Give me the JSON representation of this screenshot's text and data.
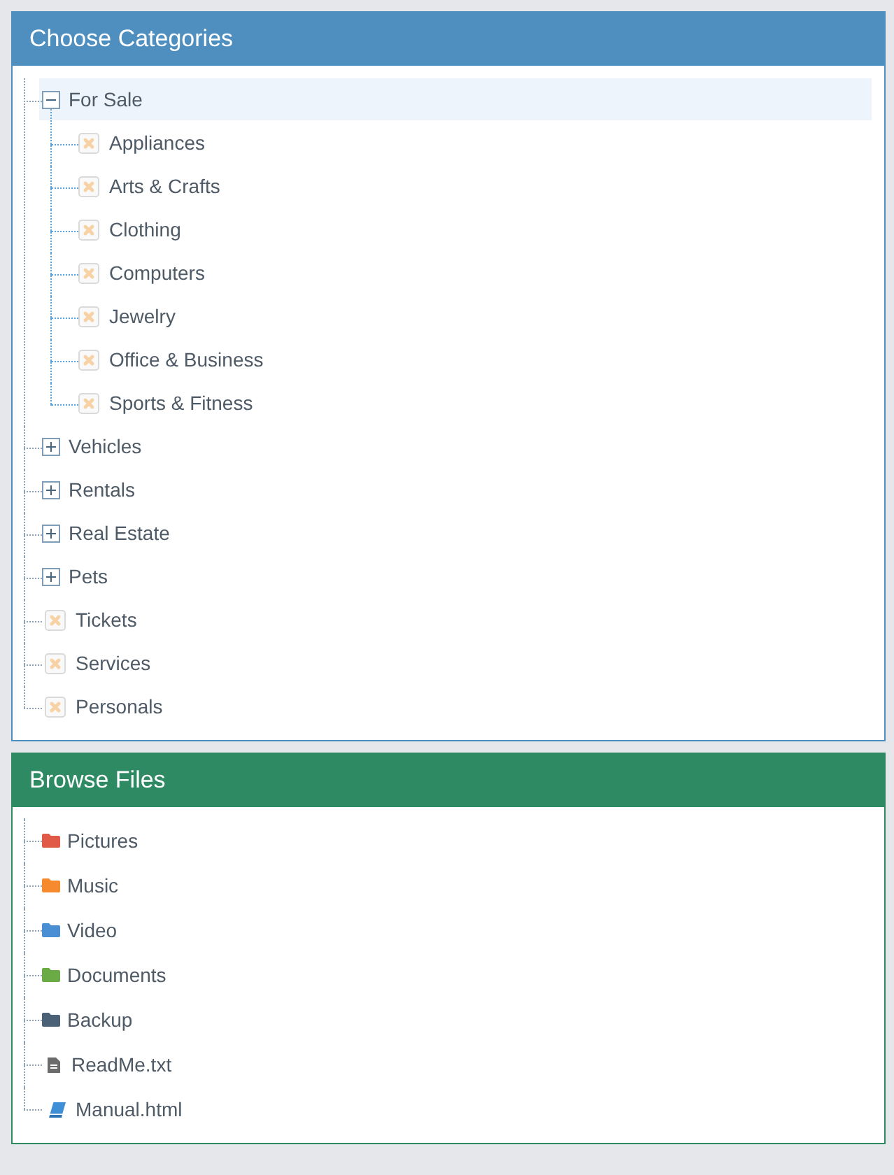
{
  "categories": {
    "title": "Choose Categories",
    "items": [
      {
        "label": "For Sale",
        "kind": "group",
        "expanded": true,
        "selected": true,
        "children": [
          {
            "label": "Appliances",
            "kind": "leaf",
            "selected": false
          },
          {
            "label": "Arts & Crafts",
            "kind": "leaf",
            "selected": false
          },
          {
            "label": "Clothing",
            "kind": "leaf",
            "selected": false
          },
          {
            "label": "Computers",
            "kind": "leaf",
            "selected": false
          },
          {
            "label": "Jewelry",
            "kind": "leaf",
            "selected": false
          },
          {
            "label": "Office & Business",
            "kind": "leaf",
            "selected": false
          },
          {
            "label": "Sports & Fitness",
            "kind": "leaf",
            "selected": false
          }
        ]
      },
      {
        "label": "Vehicles",
        "kind": "group",
        "expanded": false,
        "selected": false
      },
      {
        "label": "Rentals",
        "kind": "group",
        "expanded": false,
        "selected": false
      },
      {
        "label": "Real Estate",
        "kind": "group",
        "expanded": false,
        "selected": false
      },
      {
        "label": "Pets",
        "kind": "group",
        "expanded": false,
        "selected": false
      },
      {
        "label": "Tickets",
        "kind": "leaf",
        "selected": false
      },
      {
        "label": "Services",
        "kind": "leaf",
        "selected": false
      },
      {
        "label": "Personals",
        "kind": "leaf",
        "selected": false
      }
    ]
  },
  "files": {
    "title": "Browse Files",
    "items": [
      {
        "label": "Pictures",
        "kind": "folder",
        "color": "#e05a47"
      },
      {
        "label": "Music",
        "kind": "folder",
        "color": "#f68a2e"
      },
      {
        "label": "Video",
        "kind": "folder",
        "color": "#4a8fd4"
      },
      {
        "label": "Documents",
        "kind": "folder",
        "color": "#6aab45"
      },
      {
        "label": "Backup",
        "kind": "folder",
        "color": "#4b6276"
      },
      {
        "label": "ReadMe.txt",
        "kind": "document"
      },
      {
        "label": "Manual.html",
        "kind": "book"
      }
    ]
  }
}
